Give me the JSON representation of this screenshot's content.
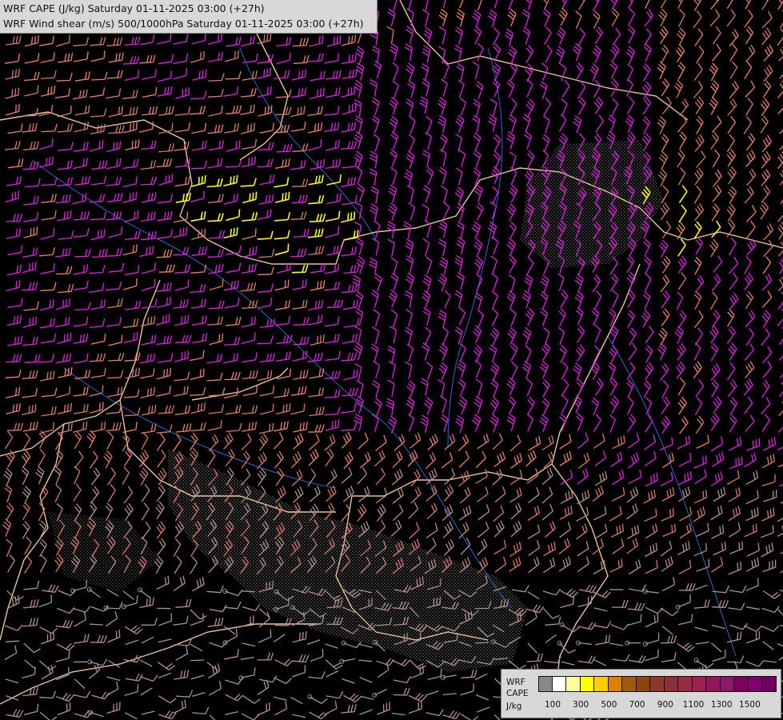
{
  "header": {
    "line1": "WRF CAPE (J/kg) Saturday 01-11-2025 03:00 (+27h)",
    "line2": "WRF Wind shear (m/s) 500/1000hPa Saturday 01-11-2025 03:00 (+27h)"
  },
  "legend": {
    "label_line1": "WRF",
    "label_line2": "CAPE",
    "label_line3": "J/kg",
    "colors": [
      "#888888",
      "#ffffff",
      "#ffff99",
      "#ffff00",
      "#ffcc00",
      "#e08000",
      "#a05a10",
      "#8b4513",
      "#8b3a2a",
      "#8f2f3a",
      "#9a2a45",
      "#a02050",
      "#901858",
      "#901868",
      "#800060",
      "#800070",
      "#700060"
    ],
    "tick_labels": [
      "100",
      "300",
      "500",
      "700",
      "900",
      "1100",
      "1300",
      "1500"
    ]
  },
  "map": {
    "barb_colors": {
      "grey": "#9a9a9a",
      "pink_grey": "#b88f8f",
      "salmon": "#d87a6a",
      "coral": "#f08070",
      "magenta": "#e020e0",
      "yellow": "#ffff00"
    },
    "border_color": "#e8c49a",
    "river_color": "#3366cc",
    "stipple_color": "#9a9a9a"
  }
}
